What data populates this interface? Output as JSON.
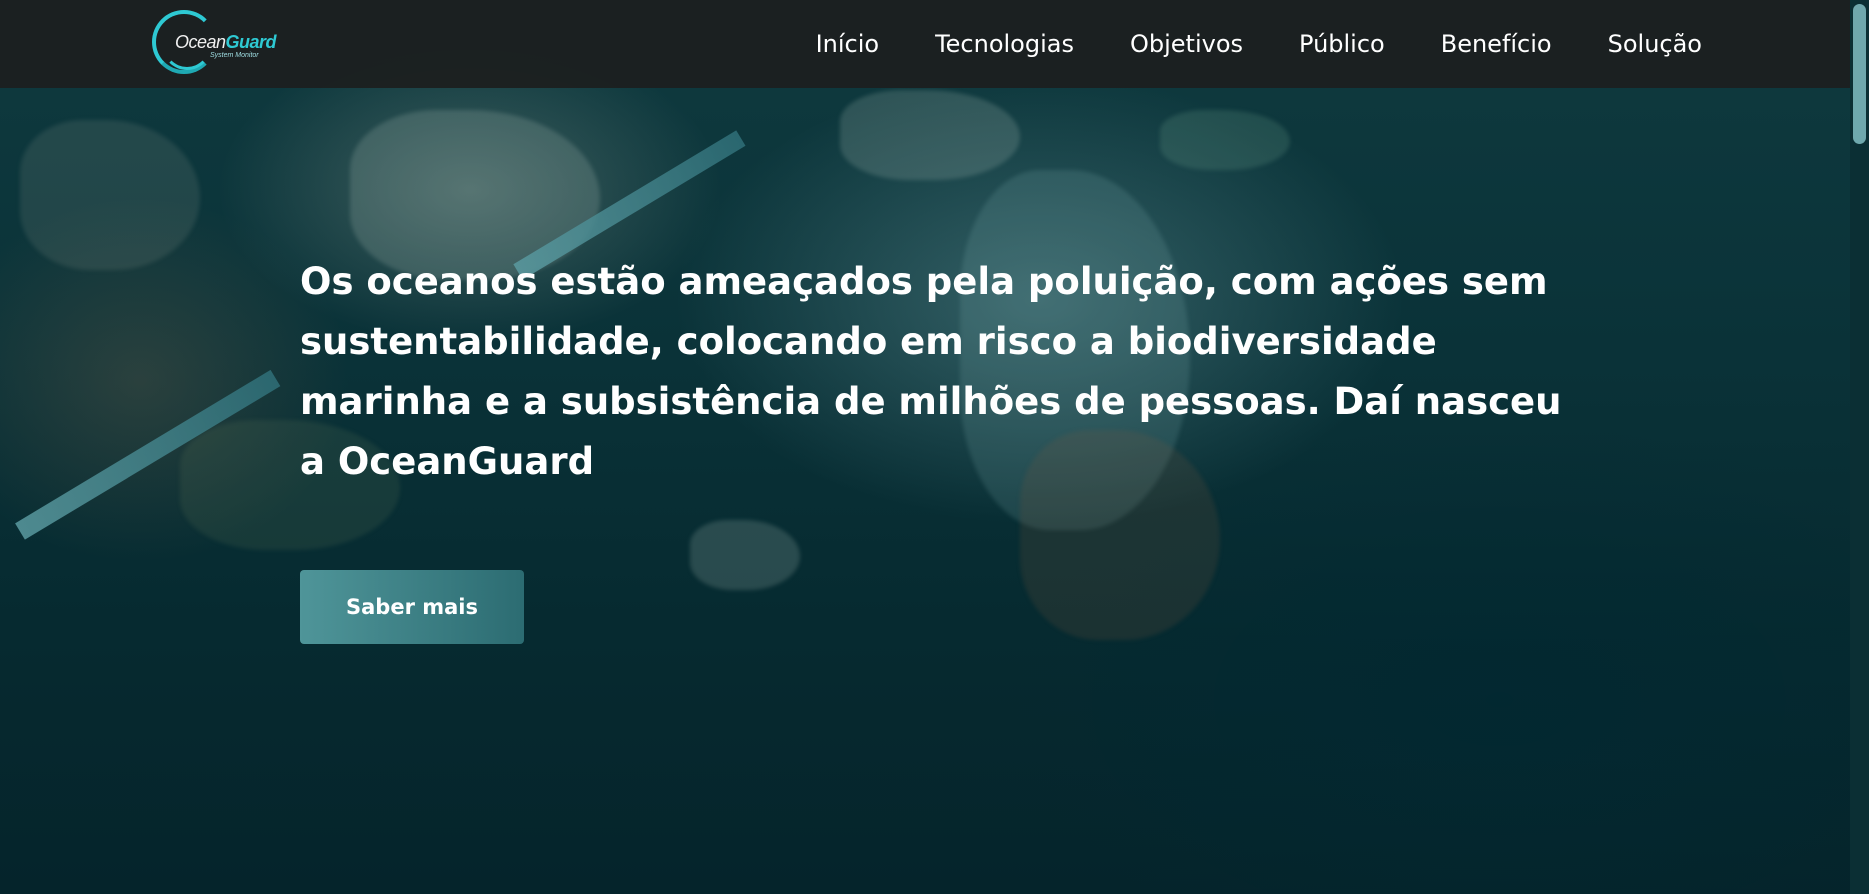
{
  "header": {
    "logo": {
      "name_part1": "Ocean",
      "name_part2": "Guard",
      "tagline": "System Monitor"
    },
    "nav": [
      {
        "label": "Início"
      },
      {
        "label": "Tecnologias"
      },
      {
        "label": "Objetivos"
      },
      {
        "label": "Público"
      },
      {
        "label": "Benefício"
      },
      {
        "label": "Solução"
      }
    ]
  },
  "hero": {
    "headline": "Os oceanos estão ameaçados pela poluição, com ações sem sustentabilidade, colocando em risco a biodiversidade marinha e a subsistência de milhões de pessoas. Daí nasceu a OceanGuard",
    "cta_label": "Saber mais"
  },
  "colors": {
    "accent": "#2ec9d3",
    "button_gradient_start": "#4f9599",
    "button_gradient_end": "#2c6c72",
    "navbar_bg": "#1c1e1e"
  },
  "icons": {
    "logo": "oceanguard-logo-icon"
  }
}
